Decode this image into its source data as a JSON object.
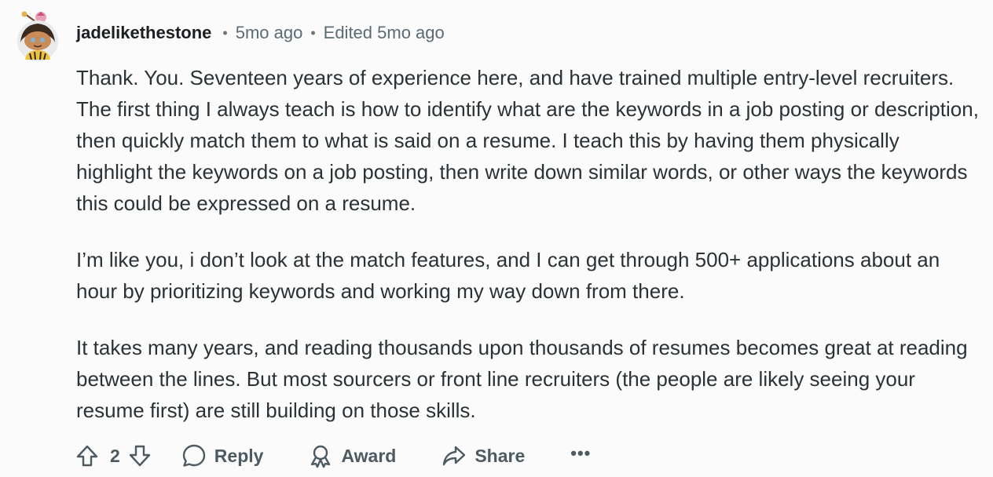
{
  "comment": {
    "author": "jadelikethestone",
    "separator": "•",
    "posted": "5mo ago",
    "edited": "Edited 5mo ago",
    "paragraphs": [
      "Thank. You. Seventeen years of experience here, and have trained multiple entry-level recruiters. The first thing I always teach is how to identify what are the keywords in a job posting or description, then quickly match them to what is said on a resume. I teach this by having them physically highlight the keywords on a job posting, then write down similar words, or other ways the keywords this could be expressed on a resume.",
      "I’m like you, i don’t look at the match features, and I can get through 500+ applications about an hour by prioritizing keywords and working my way down from there.",
      "It takes many years, and reading thousands upon thousands of resumes becomes great at reading between the lines. But most sourcers or front line recruiters (the people are likely seeing your resume first) are still building on those skills."
    ]
  },
  "actions": {
    "score": "2",
    "reply_label": "Reply",
    "award_label": "Award",
    "share_label": "Share",
    "more_label": "•••"
  },
  "icons": {
    "upvote": "upvote-arrow-icon",
    "downvote": "downvote-arrow-icon",
    "reply": "speech-bubble-icon",
    "award": "award-ribbon-icon",
    "share": "share-arrow-icon",
    "avatar": "snoo-avatar"
  },
  "colors": {
    "background": "#fbfbfb",
    "text": "#2a3236",
    "meta": "#5c6a73",
    "action": "#4e5a61"
  }
}
